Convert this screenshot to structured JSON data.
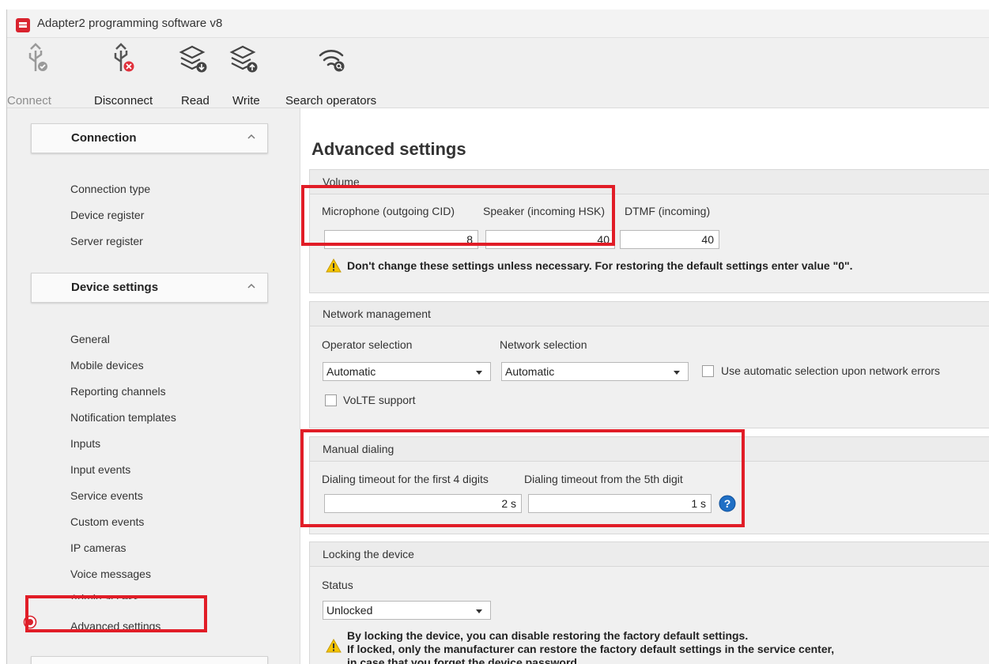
{
  "window": {
    "title": "Adapter2 programming software v8"
  },
  "toolbar": {
    "connect": "Connect",
    "disconnect": "Disconnect",
    "read": "Read",
    "write": "Write",
    "search_operators": "Search operators"
  },
  "sidebar": {
    "sections": [
      {
        "title": "Connection",
        "items": [
          "Connection type",
          "Device register",
          "Server register"
        ]
      },
      {
        "title": "Device settings",
        "items": [
          "General",
          "Mobile devices",
          "Reporting channels",
          "Notification templates",
          "Inputs",
          "Input events",
          "Service events",
          "Custom events",
          "IP cameras",
          "Voice messages",
          "Admin access",
          "Advanced settings"
        ]
      }
    ],
    "selected": "Advanced settings"
  },
  "main": {
    "title": "Advanced settings",
    "volume": {
      "title": "Volume",
      "microphone_label": "Microphone (outgoing CID)",
      "microphone_value": "8",
      "speaker_label": "Speaker (incoming HSK)",
      "speaker_value": "40",
      "dtmf_label": "DTMF (incoming)",
      "dtmf_value": "40",
      "warning": "Don't change these settings unless necessary. For restoring the default settings enter value \"0\"."
    },
    "network": {
      "title": "Network management",
      "operator_label": "Operator selection",
      "operator_value": "Automatic",
      "network_label": "Network selection",
      "network_value": "Automatic",
      "auto_errors_label": "Use automatic selection upon network errors",
      "volte_label": "VoLTE support"
    },
    "dialing": {
      "title": "Manual dialing",
      "first_label": "Dialing timeout for the first 4 digits",
      "first_value": "2 s",
      "fifth_label": "Dialing timeout from the 5th digit",
      "fifth_value": "1 s"
    },
    "locking": {
      "title": "Locking the device",
      "status_label": "Status",
      "status_value": "Unlocked",
      "warning_lines": [
        "By locking the device, you can disable restoring the factory default settings.",
        "If locked, only the manufacturer can restore the factory default settings in the service center,",
        "in case that you forget the device password."
      ]
    }
  },
  "colors": {
    "highlight": "#e11d27",
    "accent": "#1f6fc5",
    "warning": "#f5c400"
  },
  "icons": [
    "usb-check-icon",
    "usb-disconnect-icon",
    "layers-read-icon",
    "layers-write-icon",
    "signal-search-icon",
    "chevron-up-icon",
    "warning-icon",
    "help-icon",
    "radio-selected-icon"
  ]
}
